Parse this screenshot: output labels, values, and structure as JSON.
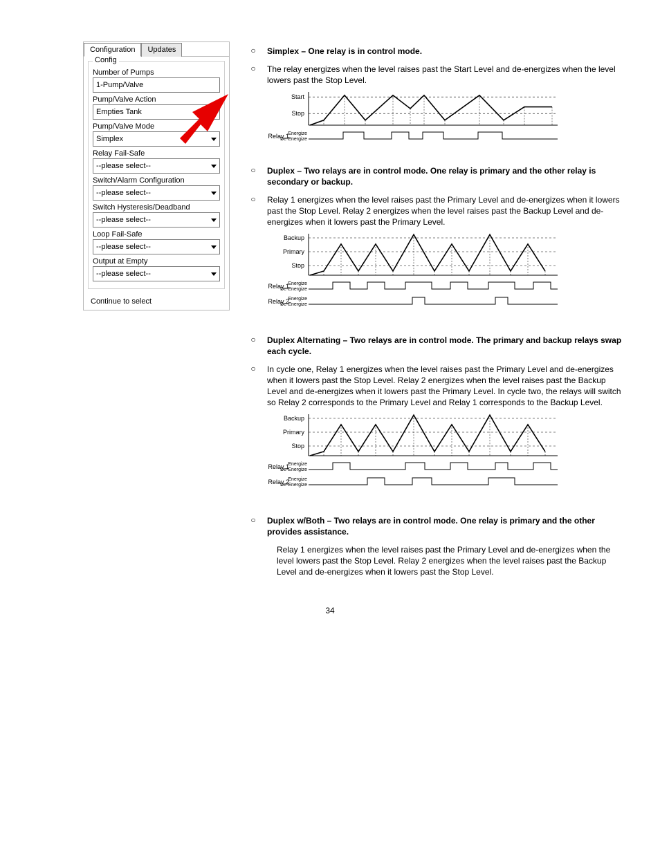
{
  "panel": {
    "tabs": {
      "active": "Configuration",
      "other": "Updates"
    },
    "group_title": "Config",
    "fields": [
      {
        "label": "Number of Pumps",
        "value": "1-Pump/Valve",
        "dropdown": false
      },
      {
        "label": "Pump/Valve Action",
        "value": "Empties Tank",
        "dropdown": true
      },
      {
        "label": "Pump/Valve Mode",
        "value": "Simplex",
        "dropdown": true
      },
      {
        "label": "Relay Fail-Safe",
        "value": "--please select--",
        "dropdown": true
      },
      {
        "label": "Switch/Alarm Configuration",
        "value": "--please select--",
        "dropdown": true
      },
      {
        "label": "Switch Hysteresis/Deadband",
        "value": "--please select--",
        "dropdown": true
      },
      {
        "label": "Loop Fail-Safe",
        "value": "--please select--",
        "dropdown": true
      },
      {
        "label": "Output at Empty",
        "value": "--please select--",
        "dropdown": true
      }
    ],
    "continue": "Continue to select"
  },
  "content": {
    "simplex_title": "Simplex – One relay is in control mode.",
    "simplex_desc": "The relay energizes when the level raises past the Start Level and de-energizes when the level lowers past the Stop Level.",
    "duplex_title": "Duplex – Two relays are in control mode. One relay is primary and the other relay is secondary or backup.",
    "duplex_desc": "Relay 1 energizes when the level raises past the Primary Level and de-energizes when it lowers past the Stop Level. Relay 2 energizes when the level raises past the Backup Level and de-energizes when it lowers past the Primary Level.",
    "duplex_alt_title": "Duplex Alternating – Two relays are in control mode. The primary and backup relays swap each cycle.",
    "duplex_alt_desc": "In cycle one, Relay 1 energizes when the level raises past the Primary Level and de-energizes when it lowers past the Stop Level. Relay 2 energizes when the level raises past the Backup Level and de-energizes when it lowers past the Primary Level. In cycle two, the relays will switch so Relay 2 corresponds to the Primary Level and Relay 1 corresponds to the Backup Level.",
    "duplex_both_title": "Duplex w/Both – Two relays are in control mode. One relay is primary and the other provides assistance.",
    "duplex_both_desc": "Relay 1 energizes when the level raises past the Primary Level and de-energizes when the level lowers past the Stop Level. Relay 2 energizes when the level raises past the Backup Level and de-energizes when it lowers past the Stop Level."
  },
  "diagrams": {
    "simplex": {
      "y_labels": [
        "Start",
        "Stop"
      ],
      "relays": [
        {
          "name": "Relay 1",
          "en": "Energize",
          "de": "De-Energize"
        }
      ]
    },
    "duplex": {
      "y_labels": [
        "Backup",
        "Primary",
        "Stop"
      ],
      "relays": [
        {
          "name": "Relay 1",
          "en": "Energize",
          "de": "De-Energize"
        },
        {
          "name": "Relay 2",
          "en": "Energize",
          "de": "De-Energize"
        }
      ]
    },
    "duplex_alt": {
      "y_labels": [
        "Backup",
        "Primary",
        "Stop"
      ],
      "relays": [
        {
          "name": "Relay 1",
          "en": "Energize",
          "de": "De-Energize"
        },
        {
          "name": "Relay 2",
          "en": "Energize",
          "de": "De-Energize"
        }
      ]
    }
  },
  "page_number": "34"
}
